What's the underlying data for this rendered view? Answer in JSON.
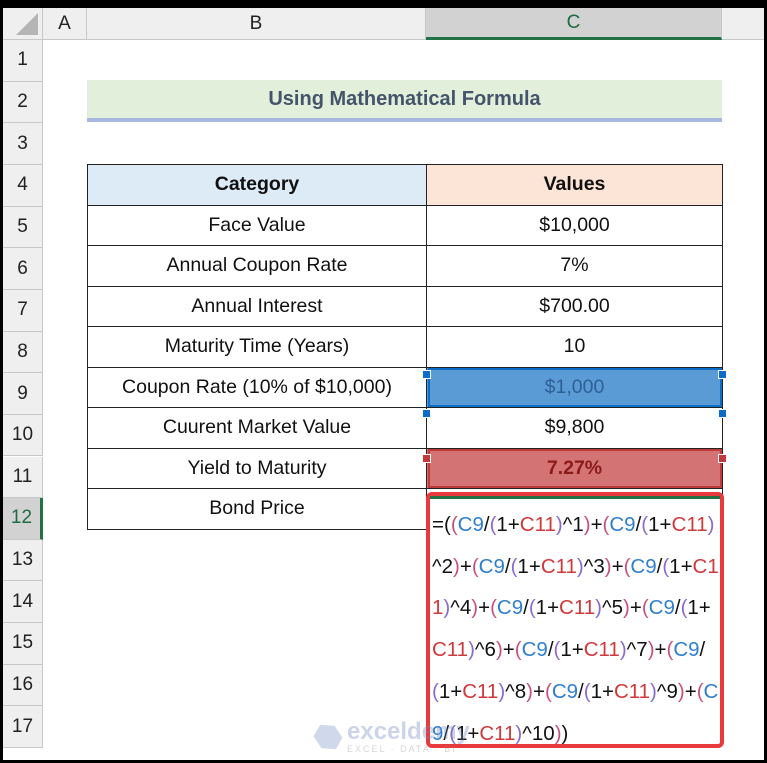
{
  "columns": [
    "A",
    "B",
    "C"
  ],
  "selected_column": "C",
  "rows": [
    "1",
    "2",
    "3",
    "4",
    "5",
    "6",
    "7",
    "8",
    "9",
    "10",
    "11",
    "12",
    "13",
    "14",
    "15",
    "16",
    "17"
  ],
  "selected_row": "12",
  "title": "Using Mathematical Formula",
  "table": {
    "headers": {
      "category": "Category",
      "values": "Values"
    },
    "rows": [
      {
        "category": "Face Value",
        "value": "$10,000"
      },
      {
        "category": "Annual Coupon Rate",
        "value": "7%"
      },
      {
        "category": "Annual Interest",
        "value": "$700.00"
      },
      {
        "category": "Maturity Time (Years)",
        "value": "10"
      },
      {
        "category": "Coupon Rate (10% of $10,000)",
        "value": "$1,000"
      },
      {
        "category": "Cuurent Market Value",
        "value": "$9,800"
      },
      {
        "category": "Yield to Maturity",
        "value": "7.27%"
      },
      {
        "category": "Bond Price",
        "value": ""
      }
    ]
  },
  "formula": {
    "text": "=((C9/(1+C11)^1)+(C9/(1+C11)^2)+(C9/(1+C11)^3)+(C9/(1+C11)^4)+(C9/(1+C11)^5)+(C9/(1+C11)^6)+(C9/(1+C11)^7)+(C9/(1+C11)^8)+(C9/(1+C11)^9)+(C9/(1+C11)^10))",
    "ref_colors": {
      "C9": "#2f7fcf",
      "C11": "#d0393b"
    },
    "terms": [
      "1",
      "2",
      "3",
      "4",
      "5",
      "6",
      "7",
      "8",
      "9",
      "10"
    ]
  },
  "watermark": {
    "name": "exceldemy",
    "tagline": "EXCEL · DATA · BI"
  },
  "colors": {
    "highlight_blue": "#5b9bd5",
    "highlight_red": "#d47373",
    "formula_border": "#e8393d",
    "excel_green": "#217346"
  }
}
